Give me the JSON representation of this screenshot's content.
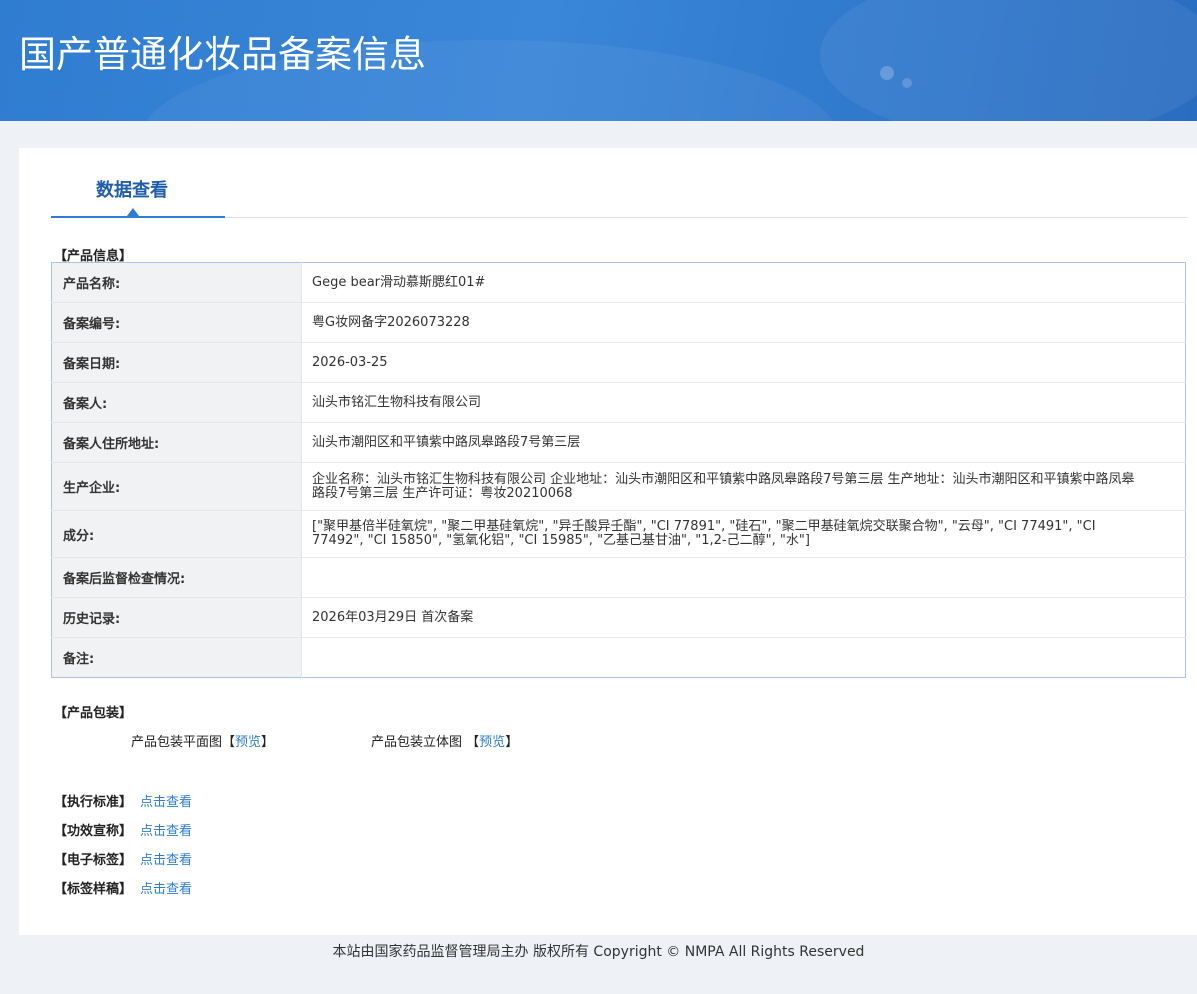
{
  "header": {
    "title": "国产普通化妆品备案信息"
  },
  "tab": {
    "label": "数据查看"
  },
  "product_info": {
    "section_label": "【产品信息】",
    "rows": [
      {
        "key": "产品名称:",
        "value": "Gege bear滑动慕斯腮红01#"
      },
      {
        "key": "备案编号:",
        "value": "粤G妆网备字2026073228"
      },
      {
        "key": "备案日期:",
        "value": "2026-03-25"
      },
      {
        "key": "备案人:",
        "value": "汕头市铭汇生物科技有限公司"
      },
      {
        "key": "备案人住所地址:",
        "value": "汕头市潮阳区和平镇紫中路凤皋路段7号第三层"
      },
      {
        "key": "生产企业:",
        "value": "企业名称：汕头市铭汇生物科技有限公司 企业地址：汕头市潮阳区和平镇紫中路凤皋路段7号第三层 生产地址：汕头市潮阳区和平镇紫中路凤皋路段7号第三层 生产许可证：粤妆20210068"
      },
      {
        "key": "成分:",
        "value": "[\"聚甲基倍半硅氧烷\", \"聚二甲基硅氧烷\", \"异壬酸异壬酯\", \"CI 77891\", \"硅石\", \"聚二甲基硅氧烷交联聚合物\", \"云母\", \"CI 77491\", \"CI 77492\", \"CI 15850\", \"氢氧化铝\", \"CI 15985\", \"乙基己基甘油\", \"1,2-己二醇\", \"水\"]"
      },
      {
        "key": "备案后监督检查情况:",
        "value": ""
      },
      {
        "key": "历史记录:",
        "value": "2026年03月29日 首次备案"
      },
      {
        "key": "备注:",
        "value": ""
      }
    ]
  },
  "packaging": {
    "section_label": "【产品包装】",
    "flat_label": "产品包装平面图",
    "flat_link": "预览",
    "solid_label": "产品包装立体图",
    "solid_link": "预览",
    "bracket_open": "【",
    "bracket_close": "】"
  },
  "documents": [
    {
      "label": "【执行标准】",
      "link": "点击查看"
    },
    {
      "label": "【功效宣称】",
      "link": "点击查看"
    },
    {
      "label": "【电子标签】",
      "link": "点击查看"
    },
    {
      "label": "【标签样稿】",
      "link": "点击查看"
    }
  ],
  "footer": {
    "text": "本站由国家药品监督管理局主办 版权所有 Copyright © NMPA All Rights Reserved"
  },
  "colors": {
    "accent": "#2f7dd1",
    "banner": "#3a86d8",
    "tab_text": "#1f5fa8",
    "key_bg": "#f1f2f4"
  }
}
